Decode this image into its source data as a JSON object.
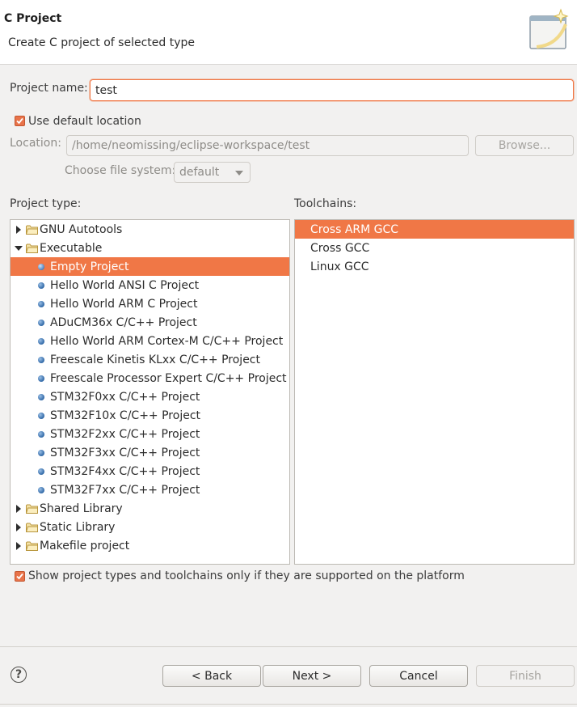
{
  "header": {
    "title": "C Project",
    "subtitle": "Create C project of selected type",
    "icon": "wizard-banner-icon"
  },
  "project_name": {
    "label": "Project name:",
    "value": "test"
  },
  "default_location": {
    "label": "Use default location",
    "checked": true
  },
  "location": {
    "label": "Location:",
    "value": "/home/neomissing/eclipse-workspace/test",
    "browse_label": "Browse..."
  },
  "file_system": {
    "label": "Choose file system:",
    "value": "default"
  },
  "project_type": {
    "label": "Project type:",
    "items": [
      {
        "label": "GNU Autotools",
        "kind": "folder",
        "expanded": false
      },
      {
        "label": "Executable",
        "kind": "folder",
        "expanded": true
      },
      {
        "label": "Empty Project",
        "kind": "leaf",
        "selected": true
      },
      {
        "label": "Hello World ANSI C Project",
        "kind": "leaf"
      },
      {
        "label": "Hello World ARM C Project",
        "kind": "leaf"
      },
      {
        "label": "ADuCM36x C/C++ Project",
        "kind": "leaf"
      },
      {
        "label": "Hello World ARM Cortex-M C/C++ Project",
        "kind": "leaf"
      },
      {
        "label": "Freescale Kinetis KLxx C/C++ Project",
        "kind": "leaf"
      },
      {
        "label": "Freescale Processor Expert C/C++ Project",
        "kind": "leaf"
      },
      {
        "label": "STM32F0xx C/C++ Project",
        "kind": "leaf"
      },
      {
        "label": "STM32F10x C/C++ Project",
        "kind": "leaf"
      },
      {
        "label": "STM32F2xx C/C++ Project",
        "kind": "leaf"
      },
      {
        "label": "STM32F3xx C/C++ Project",
        "kind": "leaf"
      },
      {
        "label": "STM32F4xx C/C++ Project",
        "kind": "leaf"
      },
      {
        "label": "STM32F7xx C/C++ Project",
        "kind": "leaf"
      },
      {
        "label": "Shared Library",
        "kind": "folder",
        "expanded": false
      },
      {
        "label": "Static Library",
        "kind": "folder",
        "expanded": false
      },
      {
        "label": "Makefile project",
        "kind": "folder",
        "expanded": false
      }
    ]
  },
  "toolchains": {
    "label": "Toolchains:",
    "items": [
      {
        "label": "Cross ARM GCC",
        "selected": true
      },
      {
        "label": "Cross GCC"
      },
      {
        "label": "Linux GCC"
      }
    ]
  },
  "show_supported": {
    "label": "Show project types and toolchains only if they are supported on the platform",
    "checked": true
  },
  "footer": {
    "help_label": "?",
    "back_label": "< Back",
    "next_label": "Next >",
    "cancel_label": "Cancel",
    "finish_label": "Finish"
  },
  "colors": {
    "selection": "#f07746",
    "checkbox": "#e8734a",
    "background": "#f2f1f0"
  }
}
